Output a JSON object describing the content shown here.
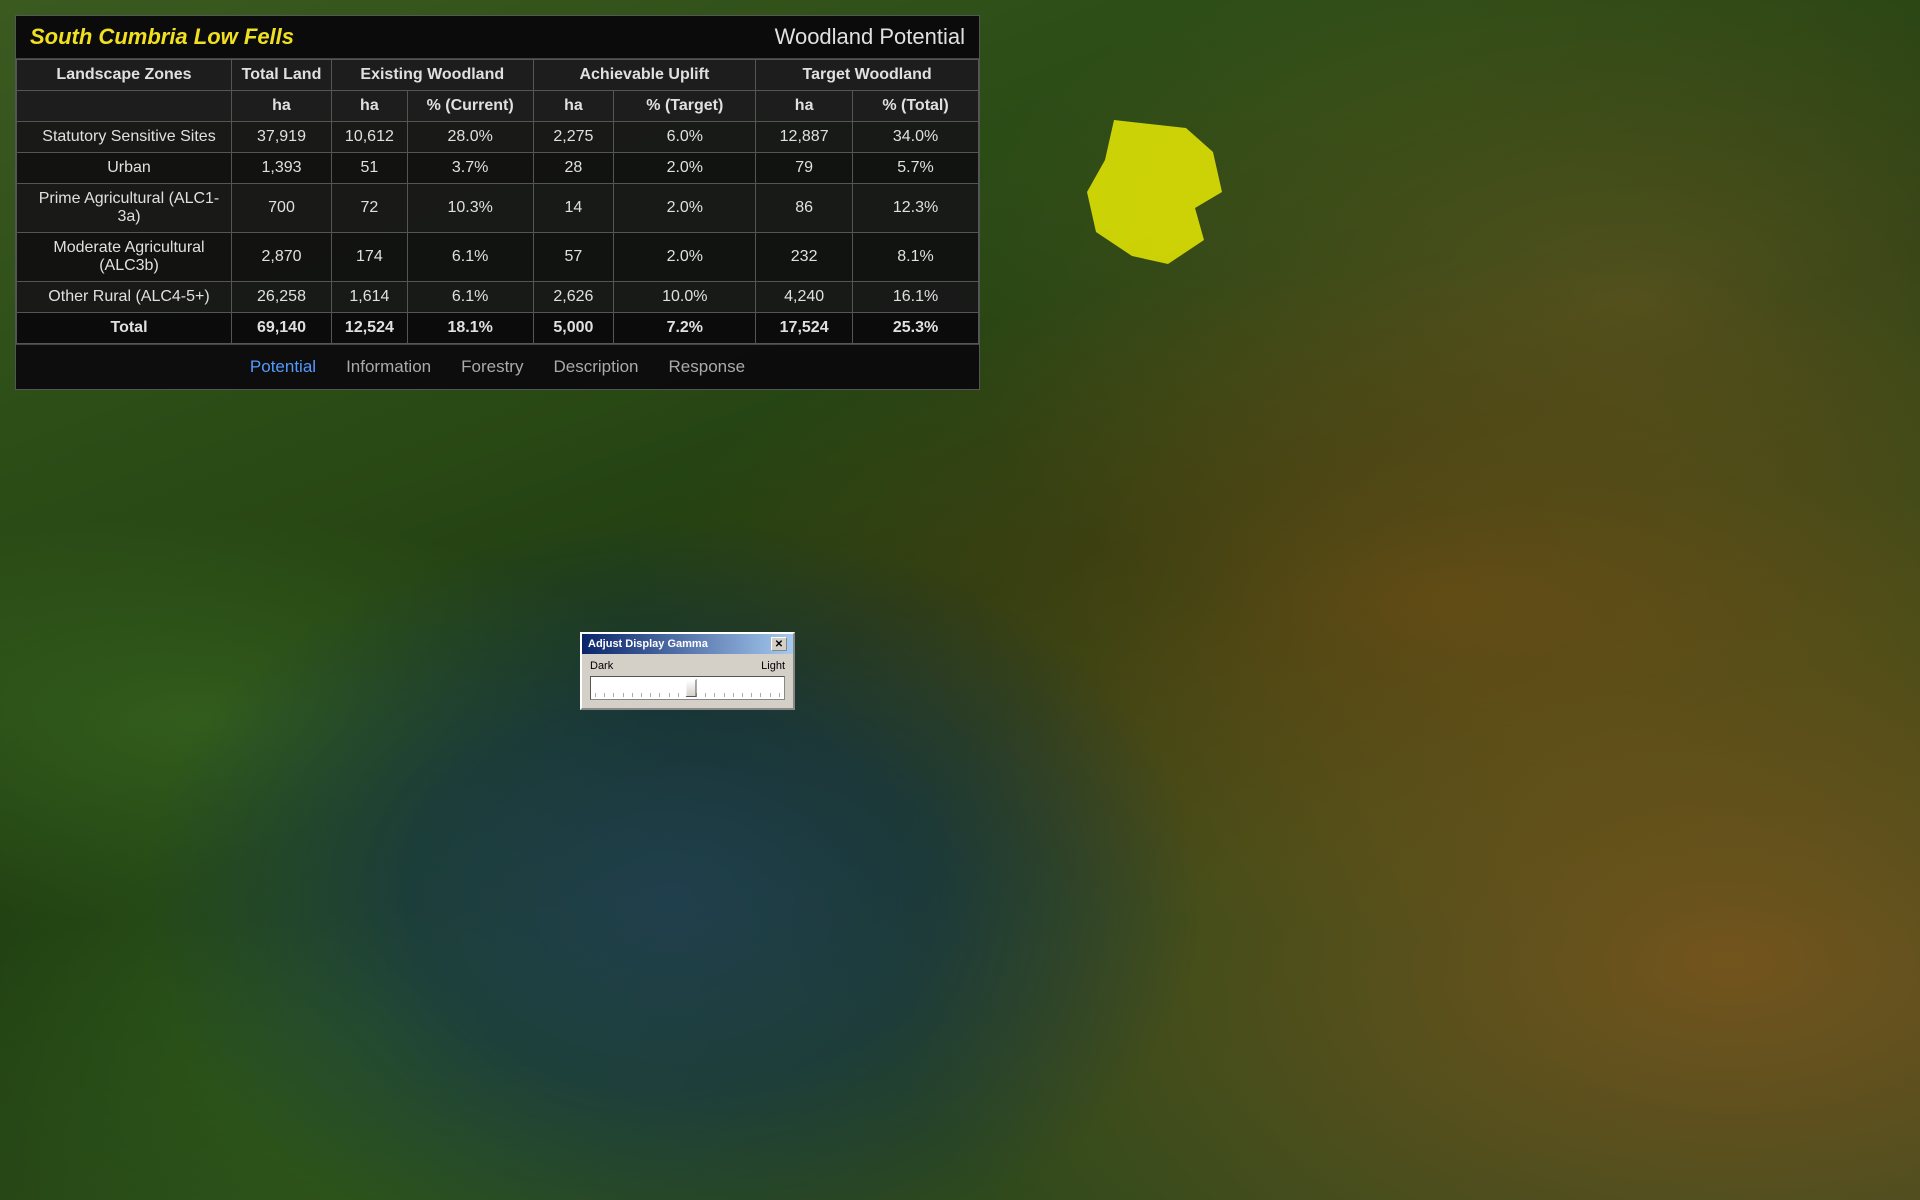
{
  "region": {
    "title": "South Cumbria Low Fells",
    "panel_title": "Woodland Potential"
  },
  "table": {
    "headers": {
      "landscape_zones": "Landscape Zones",
      "total_land": "Total Land",
      "existing_woodland": "Existing Woodland",
      "achievable_uplift": "Achievable Uplift",
      "target_woodland": "Target Woodland"
    },
    "sub_headers": {
      "total_ha": "ha",
      "existing_ha": "ha",
      "existing_pct": "% (Current)",
      "achievable_ha": "ha",
      "achievable_pct": "% (Target)",
      "target_ha": "ha",
      "target_pct": "% (Total)"
    },
    "rows": [
      {
        "zone": "Statutory Sensitive Sites",
        "total_ha": "37,919",
        "existing_ha": "10,612",
        "existing_pct": "28.0%",
        "achievable_ha": "2,275",
        "achievable_pct": "6.0%",
        "target_ha": "12,887",
        "target_pct": "34.0%"
      },
      {
        "zone": "Urban",
        "total_ha": "1,393",
        "existing_ha": "51",
        "existing_pct": "3.7%",
        "achievable_ha": "28",
        "achievable_pct": "2.0%",
        "target_ha": "79",
        "target_pct": "5.7%"
      },
      {
        "zone": "Prime Agricultural (ALC1-3a)",
        "total_ha": "700",
        "existing_ha": "72",
        "existing_pct": "10.3%",
        "achievable_ha": "14",
        "achievable_pct": "2.0%",
        "target_ha": "86",
        "target_pct": "12.3%"
      },
      {
        "zone": "Moderate Agricultural (ALC3b)",
        "total_ha": "2,870",
        "existing_ha": "174",
        "existing_pct": "6.1%",
        "achievable_ha": "57",
        "achievable_pct": "2.0%",
        "target_ha": "232",
        "target_pct": "8.1%"
      },
      {
        "zone": "Other Rural (ALC4-5+)",
        "total_ha": "26,258",
        "existing_ha": "1,614",
        "existing_pct": "6.1%",
        "achievable_ha": "2,626",
        "achievable_pct": "10.0%",
        "target_ha": "4,240",
        "target_pct": "16.1%"
      }
    ],
    "total_row": {
      "zone": "Total",
      "total_ha": "69,140",
      "existing_ha": "12,524",
      "existing_pct": "18.1%",
      "achievable_ha": "5,000",
      "achievable_pct": "7.2%",
      "target_ha": "17,524",
      "target_pct": "25.3%"
    }
  },
  "nav_tabs": [
    {
      "label": "Potential",
      "active": true
    },
    {
      "label": "Information",
      "active": false
    },
    {
      "label": "Forestry",
      "active": false
    },
    {
      "label": "Description",
      "active": false
    },
    {
      "label": "Response",
      "active": false
    }
  ],
  "gamma_dialog": {
    "title": "Adjust Display Gamma",
    "label_dark": "Dark",
    "label_light": "Light",
    "close_btn": "✕"
  }
}
